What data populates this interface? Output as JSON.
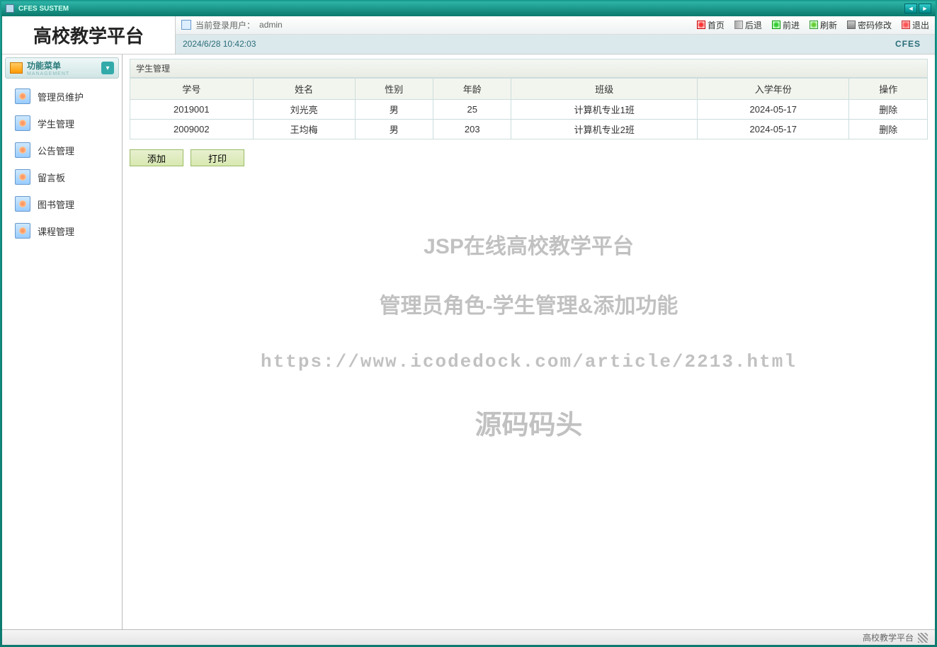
{
  "window": {
    "title": "CFES SUSTEM"
  },
  "header": {
    "logo": "高校教学平台",
    "login_prefix": "当前登录用户：",
    "login_user": "admin",
    "datetime": "2024/6/28 10:42:03",
    "brand": "CFES",
    "actions": {
      "home": "首页",
      "back": "后退",
      "forward": "前进",
      "refresh": "刷新",
      "password": "密码修改",
      "exit": "退出"
    }
  },
  "sidebar": {
    "title": "功能菜单",
    "subtitle": "MANAGEMENT",
    "items": [
      {
        "label": "管理员维护"
      },
      {
        "label": "学生管理"
      },
      {
        "label": "公告管理"
      },
      {
        "label": "留言板"
      },
      {
        "label": "图书管理"
      },
      {
        "label": "课程管理"
      }
    ]
  },
  "content": {
    "panel_title": "学生管理",
    "columns": [
      "学号",
      "姓名",
      "性别",
      "年龄",
      "班级",
      "入学年份",
      "操作"
    ],
    "rows": [
      {
        "id": "2019001",
        "name": "刘光亮",
        "gender": "男",
        "age": "25",
        "class": "计算机专业1班",
        "year": "2024-05-17",
        "op": "删除"
      },
      {
        "id": "2009002",
        "name": "王均梅",
        "gender": "男",
        "age": "203",
        "class": "计算机专业2班",
        "year": "2024-05-17",
        "op": "删除"
      }
    ],
    "buttons": {
      "add": "添加",
      "print": "打印"
    }
  },
  "watermark": {
    "line1": "JSP在线高校教学平台",
    "line2": "管理员角色-学生管理&添加功能",
    "line3": "https://www.icodedock.com/article/2213.html",
    "line4": "源码码头"
  },
  "status": {
    "text": "高校教学平台"
  }
}
